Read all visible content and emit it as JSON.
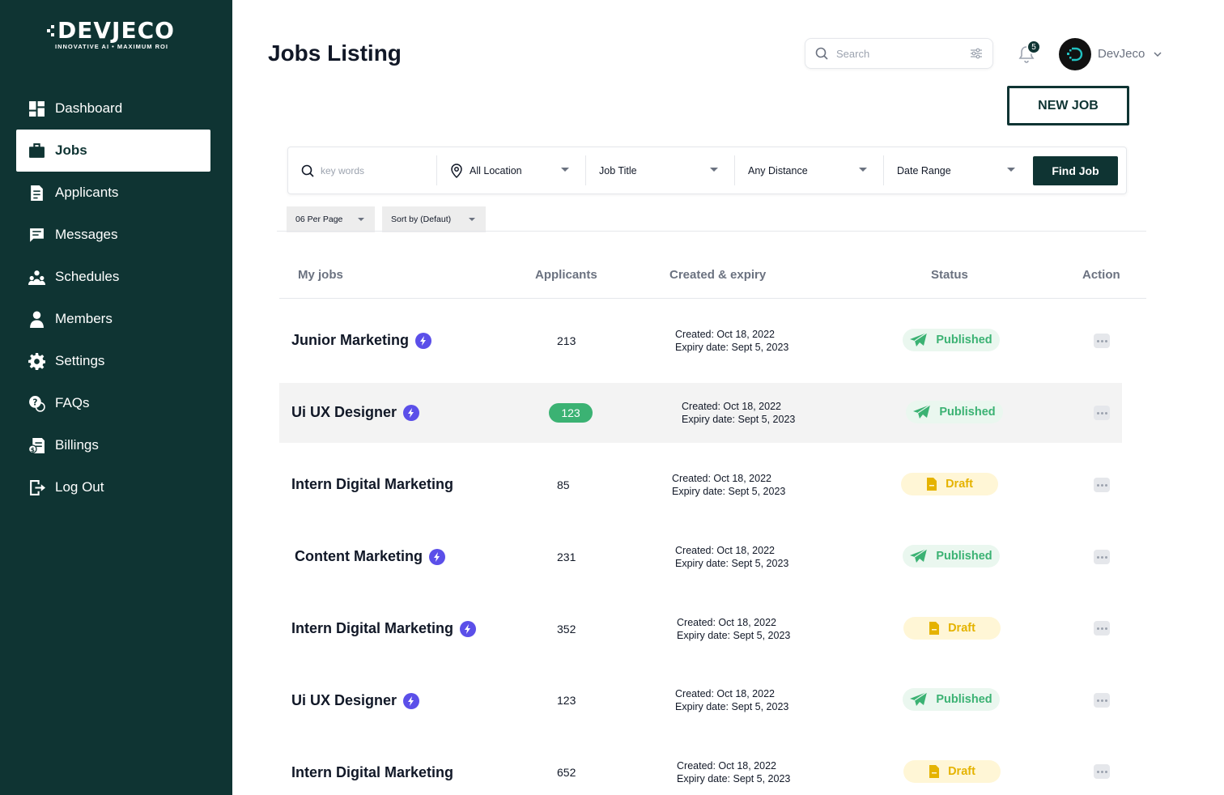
{
  "brand": {
    "name": "DEVJECO",
    "tagline": "INNOVATIVE AI • MAXIMUM ROI"
  },
  "sidebar": {
    "items": [
      {
        "label": "Dashboard",
        "icon": "dashboard-icon"
      },
      {
        "label": "Jobs",
        "icon": "briefcase-icon",
        "active": true
      },
      {
        "label": "Applicants",
        "icon": "applicants-icon"
      },
      {
        "label": "Messages",
        "icon": "message-icon"
      },
      {
        "label": "Schedules",
        "icon": "schedules-icon"
      },
      {
        "label": "Members",
        "icon": "user-icon"
      },
      {
        "label": "Settings",
        "icon": "gear-icon"
      },
      {
        "label": "FAQs",
        "icon": "faq-icon"
      },
      {
        "label": "Billings",
        "icon": "billing-icon"
      },
      {
        "label": "Log Out",
        "icon": "logout-icon"
      }
    ]
  },
  "header": {
    "title": "Jobs Listing",
    "search_placeholder": "Search",
    "notification_count": "5",
    "user_name": "DevJeco",
    "new_job_label": "NEW JOB"
  },
  "filters": {
    "keywords_placeholder": "key words",
    "location": "All Location",
    "job_title": "Job Title",
    "distance": "Any Distance",
    "date_range": "Date Range",
    "find_label": "Find Job",
    "per_page": "06 Per Page",
    "sort_by": "Sort by (Defaut)"
  },
  "table": {
    "columns": [
      "My jobs",
      "Applicants",
      "Created & expiry",
      "Status",
      "Action"
    ],
    "rows": [
      {
        "title": "Junior Marketing",
        "boosted": true,
        "applicants": "213",
        "created": "Created: Oct 18, 2022",
        "expiry": "Expiry date: Sept 5, 2023",
        "status": "Published"
      },
      {
        "title": "Ui UX Designer",
        "boosted": true,
        "applicants": "123",
        "created": "Created: Oct 18, 2022",
        "expiry": "Expiry date: Sept 5, 2023",
        "status": "Published",
        "highlighted": true
      },
      {
        "title": "Intern Digital Marketing",
        "boosted": false,
        "applicants": "85",
        "created": "Created: Oct 18, 2022",
        "expiry": "Expiry date: Sept 5, 2023",
        "status": "Draft"
      },
      {
        "title": "Content Marketing",
        "boosted": true,
        "applicants": "231",
        "created": "Created: Oct 18, 2022",
        "expiry": "Expiry date: Sept 5, 2023",
        "status": "Published"
      },
      {
        "title": "Intern Digital Marketing",
        "boosted": true,
        "applicants": "352",
        "created": "Created: Oct 18, 2022",
        "expiry": "Expiry date: Sept 5, 2023",
        "status": "Draft"
      },
      {
        "title": "Ui UX Designer",
        "boosted": true,
        "applicants": "123",
        "created": "Created: Oct 18, 2022",
        "expiry": "Expiry date: Sept 5, 2023",
        "status": "Published"
      },
      {
        "title": "Intern Digital Marketing",
        "boosted": false,
        "applicants": "652",
        "created": "Created: Oct 18, 2022",
        "expiry": "Expiry date: Sept 5, 2023",
        "status": "Draft"
      }
    ]
  },
  "colors": {
    "sidebar": "#0f3433",
    "published": "#3bb273",
    "draft": "#e5b300",
    "boost": "#5b4fe9"
  }
}
